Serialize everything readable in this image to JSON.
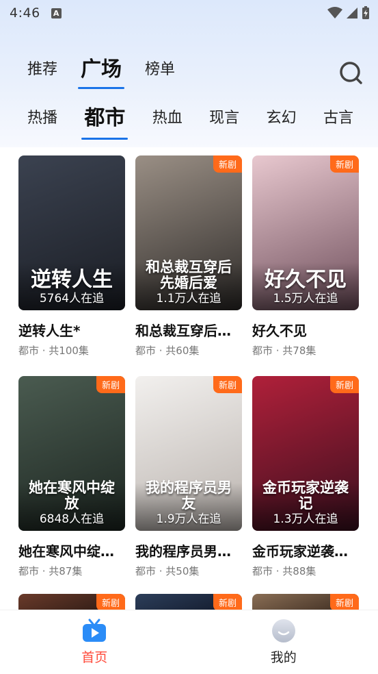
{
  "status_bar": {
    "time": "4:46",
    "notification_letter": "A"
  },
  "main_tabs": [
    {
      "label": "推荐",
      "active": false
    },
    {
      "label": "广场",
      "active": true
    },
    {
      "label": "榜单",
      "active": false
    }
  ],
  "sub_tabs": [
    {
      "label": "热播",
      "active": false
    },
    {
      "label": "都市",
      "active": true
    },
    {
      "label": "热血",
      "active": false
    },
    {
      "label": "现言",
      "active": false
    },
    {
      "label": "玄幻",
      "active": false
    },
    {
      "label": "古言",
      "active": false
    }
  ],
  "badge_label": "新剧",
  "dramas": [
    {
      "title": "逆转人生*",
      "poster_text": "逆转人生",
      "watching": "5764人在追",
      "meta": "都市 · 共100集",
      "is_new": false,
      "colors": [
        "#3b4250",
        "#1a1d24"
      ]
    },
    {
      "title": "和总裁互穿后…",
      "poster_text": "和总裁互穿后 先婚后爱",
      "watching": "1.1万人在追",
      "meta": "都市 · 共60集",
      "is_new": true,
      "colors": [
        "#9a8f85",
        "#2d2a28"
      ]
    },
    {
      "title": "好久不见",
      "poster_text": "好久不见",
      "watching": "1.5万人在追",
      "meta": "都市 · 共78集",
      "is_new": true,
      "colors": [
        "#e8c8cf",
        "#6d4d5a"
      ]
    },
    {
      "title": "她在寒风中绽…",
      "poster_text": "她在寒风中绽放",
      "watching": "6848人在追",
      "meta": "都市 · 共87集",
      "is_new": true,
      "colors": [
        "#4a5b50",
        "#1c2520"
      ]
    },
    {
      "title": "我的程序员男…",
      "poster_text": "我的程序员男友",
      "watching": "1.9万人在追",
      "meta": "都市 · 共50集",
      "is_new": true,
      "colors": [
        "#f2f0ee",
        "#b9b2ad"
      ]
    },
    {
      "title": "金币玩家逆袭…",
      "poster_text": "金币玩家逆袭记",
      "watching": "1.3万人在追",
      "meta": "都市 · 共88集",
      "is_new": true,
      "colors": [
        "#b0203a",
        "#3a0f1e"
      ]
    }
  ],
  "peek_cards": [
    {
      "is_new": true,
      "colors": [
        "#6a3a2a",
        "#2a1a14"
      ]
    },
    {
      "is_new": true,
      "colors": [
        "#2c3e5a",
        "#12192a"
      ]
    },
    {
      "is_new": true,
      "colors": [
        "#8a6e55",
        "#3a2a1f"
      ]
    }
  ],
  "bottom_nav": [
    {
      "label": "首页",
      "icon": "tv-play-icon",
      "active": true,
      "accent": "#2b8cf7",
      "label_color": "#ff4a3a"
    },
    {
      "label": "我的",
      "icon": "profile-face-icon",
      "active": false
    }
  ]
}
